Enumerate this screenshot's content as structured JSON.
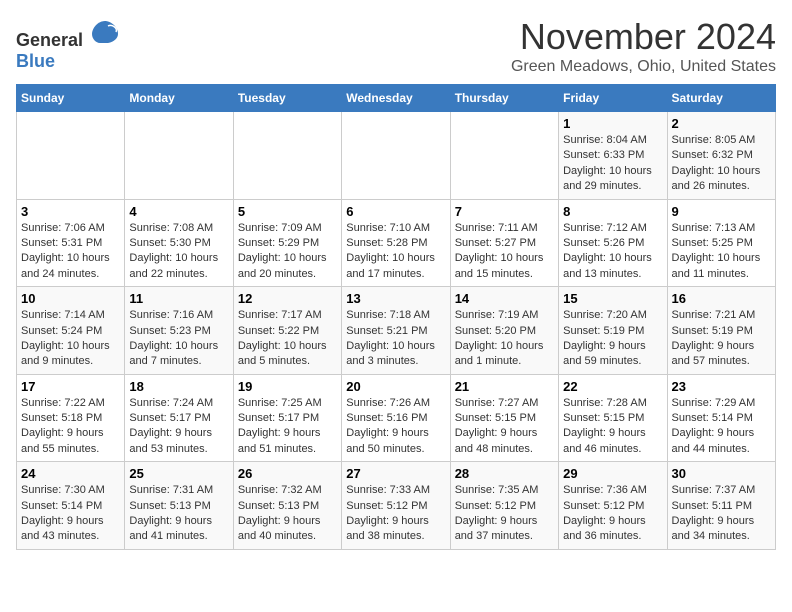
{
  "header": {
    "logo_general": "General",
    "logo_blue": "Blue",
    "month_year": "November 2024",
    "location": "Green Meadows, Ohio, United States"
  },
  "weekdays": [
    "Sunday",
    "Monday",
    "Tuesday",
    "Wednesday",
    "Thursday",
    "Friday",
    "Saturday"
  ],
  "weeks": [
    [
      {
        "day": "",
        "sunrise": "",
        "sunset": "",
        "daylight": ""
      },
      {
        "day": "",
        "sunrise": "",
        "sunset": "",
        "daylight": ""
      },
      {
        "day": "",
        "sunrise": "",
        "sunset": "",
        "daylight": ""
      },
      {
        "day": "",
        "sunrise": "",
        "sunset": "",
        "daylight": ""
      },
      {
        "day": "",
        "sunrise": "",
        "sunset": "",
        "daylight": ""
      },
      {
        "day": "1",
        "sunrise": "Sunrise: 8:04 AM",
        "sunset": "Sunset: 6:33 PM",
        "daylight": "Daylight: 10 hours and 29 minutes."
      },
      {
        "day": "2",
        "sunrise": "Sunrise: 8:05 AM",
        "sunset": "Sunset: 6:32 PM",
        "daylight": "Daylight: 10 hours and 26 minutes."
      }
    ],
    [
      {
        "day": "3",
        "sunrise": "Sunrise: 7:06 AM",
        "sunset": "Sunset: 5:31 PM",
        "daylight": "Daylight: 10 hours and 24 minutes."
      },
      {
        "day": "4",
        "sunrise": "Sunrise: 7:08 AM",
        "sunset": "Sunset: 5:30 PM",
        "daylight": "Daylight: 10 hours and 22 minutes."
      },
      {
        "day": "5",
        "sunrise": "Sunrise: 7:09 AM",
        "sunset": "Sunset: 5:29 PM",
        "daylight": "Daylight: 10 hours and 20 minutes."
      },
      {
        "day": "6",
        "sunrise": "Sunrise: 7:10 AM",
        "sunset": "Sunset: 5:28 PM",
        "daylight": "Daylight: 10 hours and 17 minutes."
      },
      {
        "day": "7",
        "sunrise": "Sunrise: 7:11 AM",
        "sunset": "Sunset: 5:27 PM",
        "daylight": "Daylight: 10 hours and 15 minutes."
      },
      {
        "day": "8",
        "sunrise": "Sunrise: 7:12 AM",
        "sunset": "Sunset: 5:26 PM",
        "daylight": "Daylight: 10 hours and 13 minutes."
      },
      {
        "day": "9",
        "sunrise": "Sunrise: 7:13 AM",
        "sunset": "Sunset: 5:25 PM",
        "daylight": "Daylight: 10 hours and 11 minutes."
      }
    ],
    [
      {
        "day": "10",
        "sunrise": "Sunrise: 7:14 AM",
        "sunset": "Sunset: 5:24 PM",
        "daylight": "Daylight: 10 hours and 9 minutes."
      },
      {
        "day": "11",
        "sunrise": "Sunrise: 7:16 AM",
        "sunset": "Sunset: 5:23 PM",
        "daylight": "Daylight: 10 hours and 7 minutes."
      },
      {
        "day": "12",
        "sunrise": "Sunrise: 7:17 AM",
        "sunset": "Sunset: 5:22 PM",
        "daylight": "Daylight: 10 hours and 5 minutes."
      },
      {
        "day": "13",
        "sunrise": "Sunrise: 7:18 AM",
        "sunset": "Sunset: 5:21 PM",
        "daylight": "Daylight: 10 hours and 3 minutes."
      },
      {
        "day": "14",
        "sunrise": "Sunrise: 7:19 AM",
        "sunset": "Sunset: 5:20 PM",
        "daylight": "Daylight: 10 hours and 1 minute."
      },
      {
        "day": "15",
        "sunrise": "Sunrise: 7:20 AM",
        "sunset": "Sunset: 5:19 PM",
        "daylight": "Daylight: 9 hours and 59 minutes."
      },
      {
        "day": "16",
        "sunrise": "Sunrise: 7:21 AM",
        "sunset": "Sunset: 5:19 PM",
        "daylight": "Daylight: 9 hours and 57 minutes."
      }
    ],
    [
      {
        "day": "17",
        "sunrise": "Sunrise: 7:22 AM",
        "sunset": "Sunset: 5:18 PM",
        "daylight": "Daylight: 9 hours and 55 minutes."
      },
      {
        "day": "18",
        "sunrise": "Sunrise: 7:24 AM",
        "sunset": "Sunset: 5:17 PM",
        "daylight": "Daylight: 9 hours and 53 minutes."
      },
      {
        "day": "19",
        "sunrise": "Sunrise: 7:25 AM",
        "sunset": "Sunset: 5:17 PM",
        "daylight": "Daylight: 9 hours and 51 minutes."
      },
      {
        "day": "20",
        "sunrise": "Sunrise: 7:26 AM",
        "sunset": "Sunset: 5:16 PM",
        "daylight": "Daylight: 9 hours and 50 minutes."
      },
      {
        "day": "21",
        "sunrise": "Sunrise: 7:27 AM",
        "sunset": "Sunset: 5:15 PM",
        "daylight": "Daylight: 9 hours and 48 minutes."
      },
      {
        "day": "22",
        "sunrise": "Sunrise: 7:28 AM",
        "sunset": "Sunset: 5:15 PM",
        "daylight": "Daylight: 9 hours and 46 minutes."
      },
      {
        "day": "23",
        "sunrise": "Sunrise: 7:29 AM",
        "sunset": "Sunset: 5:14 PM",
        "daylight": "Daylight: 9 hours and 44 minutes."
      }
    ],
    [
      {
        "day": "24",
        "sunrise": "Sunrise: 7:30 AM",
        "sunset": "Sunset: 5:14 PM",
        "daylight": "Daylight: 9 hours and 43 minutes."
      },
      {
        "day": "25",
        "sunrise": "Sunrise: 7:31 AM",
        "sunset": "Sunset: 5:13 PM",
        "daylight": "Daylight: 9 hours and 41 minutes."
      },
      {
        "day": "26",
        "sunrise": "Sunrise: 7:32 AM",
        "sunset": "Sunset: 5:13 PM",
        "daylight": "Daylight: 9 hours and 40 minutes."
      },
      {
        "day": "27",
        "sunrise": "Sunrise: 7:33 AM",
        "sunset": "Sunset: 5:12 PM",
        "daylight": "Daylight: 9 hours and 38 minutes."
      },
      {
        "day": "28",
        "sunrise": "Sunrise: 7:35 AM",
        "sunset": "Sunset: 5:12 PM",
        "daylight": "Daylight: 9 hours and 37 minutes."
      },
      {
        "day": "29",
        "sunrise": "Sunrise: 7:36 AM",
        "sunset": "Sunset: 5:12 PM",
        "daylight": "Daylight: 9 hours and 36 minutes."
      },
      {
        "day": "30",
        "sunrise": "Sunrise: 7:37 AM",
        "sunset": "Sunset: 5:11 PM",
        "daylight": "Daylight: 9 hours and 34 minutes."
      }
    ]
  ]
}
